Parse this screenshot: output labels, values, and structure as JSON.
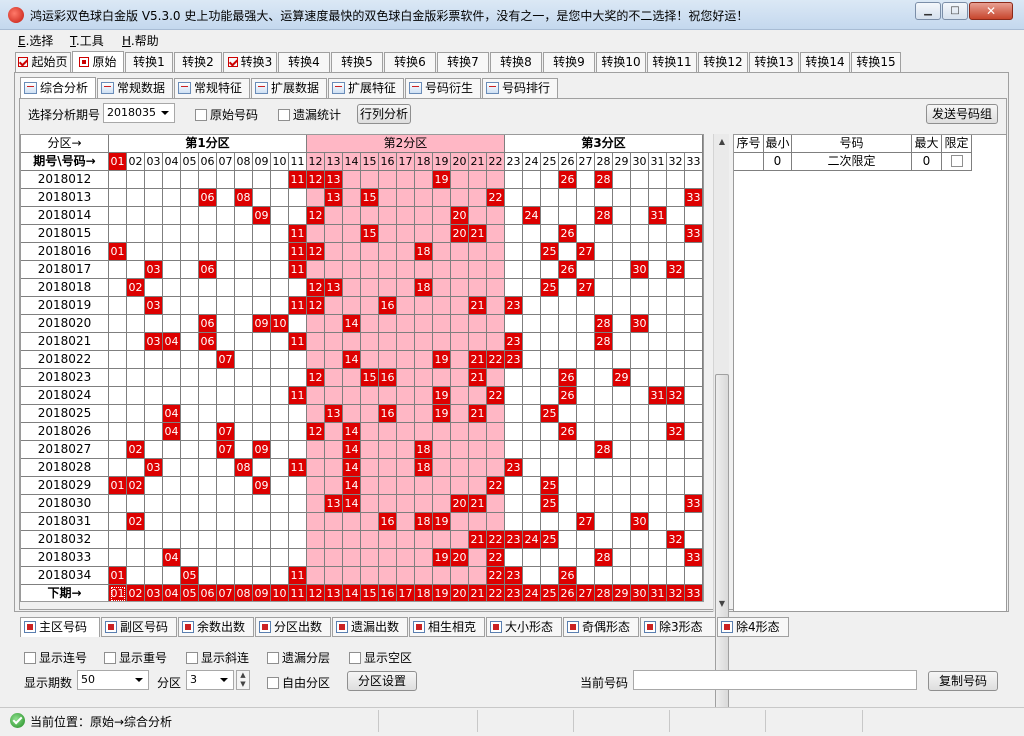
{
  "window": {
    "title": "鸿运彩双色球白金版 V5.3.0  史上功能最强大、运算速度最快的双色球白金版彩票软件，没有之一，是您中大奖的不二选择！祝您好运！"
  },
  "menu": [
    {
      "key": "E",
      "label": ".选择"
    },
    {
      "key": "T",
      "label": ".工具"
    },
    {
      "key": "H",
      "label": ".帮助"
    }
  ],
  "top_tabs": [
    "起始页",
    "原始",
    "转换1",
    "转换2",
    "转换3",
    "转换4",
    "转换5",
    "转换6",
    "转换7",
    "转换8",
    "转换9",
    "转换10",
    "转换11",
    "转换12",
    "转换13",
    "转换14",
    "转换15"
  ],
  "analysis_tabs": [
    "综合分析",
    "常规数据",
    "常规特征",
    "扩展数据",
    "扩展特征",
    "号码衍生",
    "号码排行"
  ],
  "controls": {
    "period_label": "选择分析期号",
    "period_value": "2018035",
    "original_numbers": "原始号码",
    "missing_stats": "遗漏统计",
    "row_analysis": "行列分析",
    "send_numbers": "发送号码组"
  },
  "grid": {
    "zone_label": "分区→",
    "zones": [
      "第1分区",
      "第2分区",
      "第3分区"
    ],
    "period_header": "期号\\号码→",
    "numbers": [
      "01",
      "02",
      "03",
      "04",
      "05",
      "06",
      "07",
      "08",
      "09",
      "10",
      "11",
      "12",
      "13",
      "14",
      "15",
      "16",
      "17",
      "18",
      "19",
      "20",
      "21",
      "22",
      "23",
      "24",
      "25",
      "26",
      "27",
      "28",
      "29",
      "30",
      "31",
      "32",
      "33"
    ],
    "header_highlight": [
      "01"
    ],
    "rows": [
      {
        "period": "2018012",
        "hits": [
          "11",
          "12",
          "13",
          "19",
          "26",
          "28"
        ]
      },
      {
        "period": "2018013",
        "hits": [
          "06",
          "08",
          "13",
          "15",
          "22",
          "33"
        ]
      },
      {
        "period": "2018014",
        "hits": [
          "09",
          "12",
          "20",
          "24",
          "28",
          "31"
        ]
      },
      {
        "period": "2018015",
        "hits": [
          "11",
          "15",
          "20",
          "21",
          "26",
          "33"
        ]
      },
      {
        "period": "2018016",
        "hits": [
          "01",
          "11",
          "12",
          "18",
          "25",
          "27"
        ]
      },
      {
        "period": "2018017",
        "hits": [
          "03",
          "06",
          "11",
          "26",
          "30",
          "32"
        ]
      },
      {
        "period": "2018018",
        "hits": [
          "02",
          "12",
          "13",
          "18",
          "25",
          "27"
        ]
      },
      {
        "period": "2018019",
        "hits": [
          "03",
          "11",
          "12",
          "16",
          "21",
          "23"
        ]
      },
      {
        "period": "2018020",
        "hits": [
          "06",
          "09",
          "10",
          "14",
          "28",
          "30"
        ]
      },
      {
        "period": "2018021",
        "hits": [
          "03",
          "04",
          "06",
          "11",
          "23",
          "28"
        ]
      },
      {
        "period": "2018022",
        "hits": [
          "07",
          "14",
          "19",
          "21",
          "22",
          "23"
        ]
      },
      {
        "period": "2018023",
        "hits": [
          "12",
          "15",
          "16",
          "21",
          "26",
          "29"
        ]
      },
      {
        "period": "2018024",
        "hits": [
          "11",
          "19",
          "22",
          "26",
          "31",
          "32"
        ]
      },
      {
        "period": "2018025",
        "hits": [
          "04",
          "13",
          "16",
          "19",
          "21",
          "25"
        ]
      },
      {
        "period": "2018026",
        "hits": [
          "04",
          "07",
          "12",
          "14",
          "26",
          "32"
        ]
      },
      {
        "period": "2018027",
        "hits": [
          "02",
          "07",
          "09",
          "14",
          "18",
          "28"
        ]
      },
      {
        "period": "2018028",
        "hits": [
          "03",
          "08",
          "11",
          "14",
          "18",
          "23"
        ]
      },
      {
        "period": "2018029",
        "hits": [
          "01",
          "02",
          "09",
          "14",
          "22",
          "25"
        ]
      },
      {
        "period": "2018030",
        "hits": [
          "13",
          "14",
          "20",
          "21",
          "25",
          "33"
        ]
      },
      {
        "period": "2018031",
        "hits": [
          "02",
          "16",
          "18",
          "19",
          "27",
          "30"
        ]
      },
      {
        "period": "2018032",
        "hits": [
          "21",
          "22",
          "23",
          "24",
          "25",
          "32"
        ]
      },
      {
        "period": "2018033",
        "hits": [
          "04",
          "19",
          "20",
          "22",
          "28",
          "33"
        ]
      },
      {
        "period": "2018034",
        "hits": [
          "01",
          "05",
          "11",
          "22",
          "23",
          "26"
        ]
      }
    ],
    "next_label": "下期→",
    "next_selected": "01"
  },
  "right_table": {
    "headers": [
      "序号",
      "最小",
      "号码",
      "最大",
      "限定"
    ],
    "row": {
      "seq": "",
      "min": "0",
      "name": "二次限定",
      "max": "0"
    }
  },
  "bottom_tabs": [
    "主区号码",
    "副区号码",
    "余数出数",
    "分区出数",
    "遗漏出数",
    "相生相克",
    "大小形态",
    "奇偶形态",
    "除3形态",
    "除4形态"
  ],
  "options": {
    "show_consecutive": "显示连号",
    "show_repeat": "显示重号",
    "show_diagonal": "显示斜连",
    "missing_layer": "遗漏分层",
    "show_empty_zone": "显示空区",
    "periods_label": "显示期数",
    "periods_value": "50",
    "zone_label": "分区",
    "zone_value": "3",
    "free_zone": "自由分区",
    "zone_settings": "分区设置",
    "current_label": "当前号码",
    "current_value": "",
    "copy_button": "复制号码"
  },
  "status": {
    "text": "当前位置：原始→综合分析"
  },
  "colors": {
    "hit": "#dd0000",
    "zone2": "#ffb7c5"
  }
}
